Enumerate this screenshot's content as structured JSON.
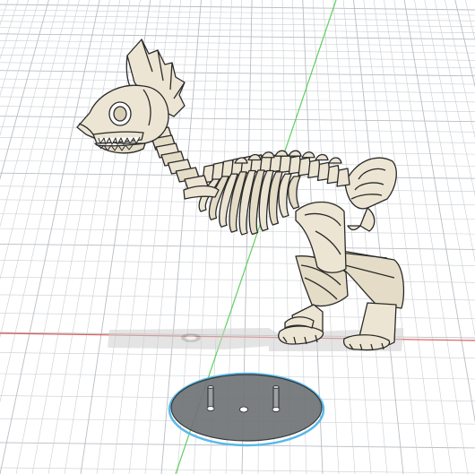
{
  "viewport": {
    "label": "",
    "colors": {
      "background": "#ffffff",
      "grid_line": "#c9ced3",
      "grid_line_major": "#b8bec4",
      "axis_x": "#e05a5a",
      "axis_y": "#5fcf5f",
      "bone_fill": "#ece5d3",
      "bone_shade": "#d8cfb6",
      "bone_stroke": "#2a2a2a",
      "base_fill": "#6f7476",
      "base_stroke": "#2a2a2a",
      "base_selection": "#5ab8e8",
      "pin_fill": "#9aa0a3",
      "shadow": "#d6d6d6"
    }
  },
  "scene": {
    "model_name": "",
    "parts": [
      {
        "name": "skull",
        "icon": "skull-icon"
      },
      {
        "name": "spine",
        "icon": "spine-icon"
      },
      {
        "name": "ribcage",
        "icon": "ribcage-icon"
      },
      {
        "name": "tail",
        "icon": "tail-icon"
      },
      {
        "name": "legs",
        "icon": "legs-icon"
      },
      {
        "name": "display-base",
        "icon": "oval-base-icon"
      }
    ]
  }
}
